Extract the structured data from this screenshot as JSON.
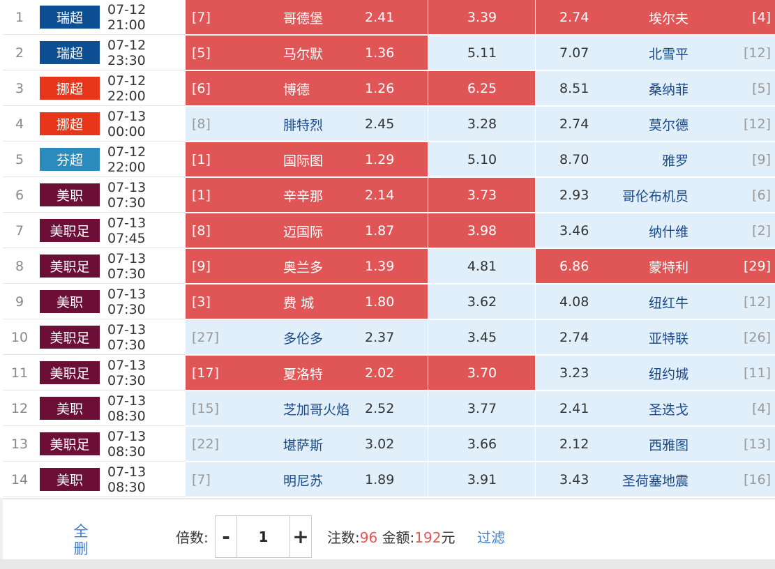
{
  "colors": {
    "selected_bg": "#e05656",
    "unselected_bg": "#e0effa",
    "dim_rank": "#999999",
    "link": "#3a7bd5",
    "league": {
      "瑞超": "#0d4f93",
      "挪超": "#e8361b",
      "芬超": "#2b8bbd",
      "美职": "#6b0f37",
      "美职足": "#6b0f37"
    }
  },
  "matches": [
    {
      "idx": "1",
      "league": "瑞超",
      "time": "07-12 21:00",
      "home_rank": "[7]",
      "home": "哥德堡",
      "home_odds": "2.41",
      "draw_odds": "3.39",
      "away_odds": "2.74",
      "away": "埃尔夫",
      "away_rank": "[4]",
      "sel": [
        true,
        true,
        true
      ]
    },
    {
      "idx": "2",
      "league": "瑞超",
      "time": "07-12 23:30",
      "home_rank": "[5]",
      "home": "马尔默",
      "home_odds": "1.36",
      "draw_odds": "5.11",
      "away_odds": "7.07",
      "away": "北雪平",
      "away_rank": "[12]",
      "sel": [
        true,
        false,
        false
      ]
    },
    {
      "idx": "3",
      "league": "挪超",
      "time": "07-12 22:00",
      "home_rank": "[6]",
      "home": "博德",
      "home_odds": "1.26",
      "draw_odds": "6.25",
      "away_odds": "8.51",
      "away": "桑纳菲",
      "away_rank": "[5]",
      "sel": [
        true,
        true,
        false
      ]
    },
    {
      "idx": "4",
      "league": "挪超",
      "time": "07-13 00:00",
      "home_rank": "[8]",
      "home": "腓特烈",
      "home_odds": "2.45",
      "draw_odds": "3.28",
      "away_odds": "2.74",
      "away": "莫尔德",
      "away_rank": "[12]",
      "sel": [
        false,
        false,
        false
      ]
    },
    {
      "idx": "5",
      "league": "芬超",
      "time": "07-12 22:00",
      "home_rank": "[1]",
      "home": "国际图",
      "home_odds": "1.29",
      "draw_odds": "5.10",
      "away_odds": "8.70",
      "away": "雅罗",
      "away_rank": "[9]",
      "sel": [
        true,
        false,
        false
      ]
    },
    {
      "idx": "6",
      "league": "美职",
      "time": "07-13 07:30",
      "home_rank": "[1]",
      "home": "辛辛那",
      "home_odds": "2.14",
      "draw_odds": "3.73",
      "away_odds": "2.93",
      "away": "哥伦布机员",
      "away_rank": "[6]",
      "sel": [
        true,
        true,
        false
      ]
    },
    {
      "idx": "7",
      "league": "美职足",
      "time": "07-13 07:45",
      "home_rank": "[8]",
      "home": "迈国际",
      "home_odds": "1.87",
      "draw_odds": "3.98",
      "away_odds": "3.46",
      "away": "纳什维",
      "away_rank": "[2]",
      "sel": [
        true,
        true,
        false
      ]
    },
    {
      "idx": "8",
      "league": "美职足",
      "time": "07-13 07:30",
      "home_rank": "[9]",
      "home": "奥兰多",
      "home_odds": "1.39",
      "draw_odds": "4.81",
      "away_odds": "6.86",
      "away": "蒙特利",
      "away_rank": "[29]",
      "sel": [
        true,
        false,
        true
      ]
    },
    {
      "idx": "9",
      "league": "美职",
      "time": "07-13 07:30",
      "home_rank": "[3]",
      "home": "费 城",
      "home_odds": "1.80",
      "draw_odds": "3.62",
      "away_odds": "4.08",
      "away": "纽红牛",
      "away_rank": "[12]",
      "sel": [
        true,
        false,
        false
      ]
    },
    {
      "idx": "10",
      "league": "美职足",
      "time": "07-13 07:30",
      "home_rank": "[27]",
      "home": "多伦多",
      "home_odds": "2.37",
      "draw_odds": "3.45",
      "away_odds": "2.74",
      "away": "亚特联",
      "away_rank": "[26]",
      "sel": [
        false,
        false,
        false
      ]
    },
    {
      "idx": "11",
      "league": "美职足",
      "time": "07-13 07:30",
      "home_rank": "[17]",
      "home": "夏洛特",
      "home_odds": "2.02",
      "draw_odds": "3.70",
      "away_odds": "3.23",
      "away": "纽约城",
      "away_rank": "[11]",
      "sel": [
        true,
        true,
        false
      ]
    },
    {
      "idx": "12",
      "league": "美职",
      "time": "07-13 08:30",
      "home_rank": "[15]",
      "home": "芝加哥火焰",
      "home_odds": "2.52",
      "draw_odds": "3.77",
      "away_odds": "2.41",
      "away": "圣迭戈",
      "away_rank": "[4]",
      "sel": [
        false,
        false,
        false
      ]
    },
    {
      "idx": "13",
      "league": "美职足",
      "time": "07-13 08:30",
      "home_rank": "[22]",
      "home": "堪萨斯",
      "home_odds": "3.02",
      "draw_odds": "3.66",
      "away_odds": "2.12",
      "away": "西雅图",
      "away_rank": "[13]",
      "sel": [
        false,
        false,
        false
      ]
    },
    {
      "idx": "14",
      "league": "美职",
      "time": "07-13 08:30",
      "home_rank": "[7]",
      "home": "明尼苏",
      "home_odds": "1.89",
      "draw_odds": "3.91",
      "away_odds": "3.43",
      "away": "圣荷塞地震",
      "away_rank": "[16]",
      "sel": [
        false,
        false,
        false
      ]
    }
  ],
  "footer": {
    "delete_all": "全删",
    "multiplier_label": "倍数:",
    "minus": "-",
    "multiplier_value": "1",
    "plus": "+",
    "bets_label": "注数:",
    "bets_value": "96",
    "amount_label": "金额:",
    "amount_value": "192",
    "amount_unit": "元",
    "filter": "过滤"
  }
}
